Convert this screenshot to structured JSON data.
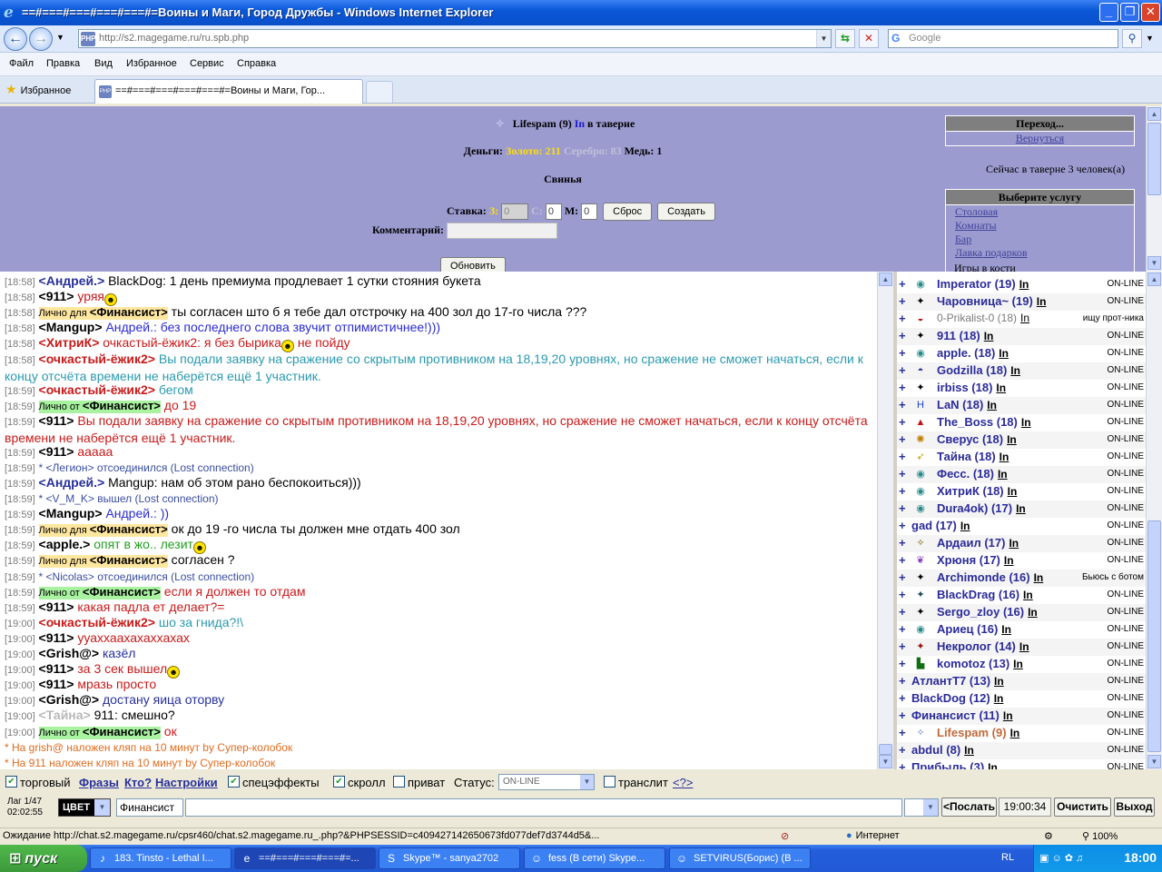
{
  "window": {
    "title": "==#===#===#===#===#=Воины и Маги, Город Дружбы - Windows Internet Explorer"
  },
  "browser": {
    "url": "http://s2.magegame.ru/ru.spb.php",
    "search_placeholder": "Google",
    "menu": [
      "Файл",
      "Правка",
      "Вид",
      "Избранное",
      "Сервис",
      "Справка"
    ],
    "favorites_label": "Избранное",
    "tab_title": "==#===#===#===#===#=Воины и Маги, Гор...",
    "status_text": "Ожидание http://chat.s2.magegame.ru/cpsr460/chat.s2.magegame.ru_.php?&PHPSESSID=c409427142650673fd077def7d3744d5&...",
    "zone": "Интернет",
    "zoom": "100%"
  },
  "tavern": {
    "player": "Lifespam (9)",
    "player_in": "In",
    "location": "в таверне",
    "money_label": "Деньги:",
    "gold": "Золото: 211",
    "silver": "Серебро: 83",
    "copper": "Медь: 1",
    "game": "Свинья",
    "bet_label": "Ставка:",
    "bet_z": "З:",
    "bet_s": "С:",
    "bet_m": "М:",
    "bet_z_val": "0",
    "bet_s_val": "0",
    "bet_m_val": "0",
    "reset": "Сброс",
    "create": "Создать",
    "comment_label": "Комментарий:",
    "refresh": "Обновить",
    "nav_header": "Переход...",
    "nav_back": "Вернуться",
    "occupants": "Сейчас в таверне 3 человек(а)",
    "service_header": "Выберите услугу",
    "services": [
      "Столовая",
      "Комнаты",
      "Бар",
      "Лавка подарков"
    ],
    "dice": "Игры в кости"
  },
  "chat": [
    {
      "ts": "[18:58]",
      "nick": "<Андрей.>",
      "nick_color": "#27309a",
      "text": "BlackDog: 1 день премиума продлевает 1 сутки стояния букета",
      "text_color": "#000000"
    },
    {
      "ts": "[18:58]",
      "nick": "<911>",
      "nick_color": "#000000",
      "text": "уряя",
      "text_color": "#c81a1a",
      "smile": true
    },
    {
      "ts": "[18:58]",
      "priv": "Лично для",
      "priv_type": "to",
      "nick": "<Финансист>",
      "text": "ты согласен што б я тебе дал отстрочку на 400 зол до 17-го числа ???",
      "text_color": "#000000"
    },
    {
      "ts": "[18:58]",
      "nick": "<Mangup>",
      "nick_color": "#000000",
      "text": "Андрей.: без последнего слова звучит отпимистичнее!)))",
      "text_color": "#2b2bd0"
    },
    {
      "ts": "[18:58]",
      "nick": "<ХитриК>",
      "nick_color": "#c81a1a",
      "text": "очкастый-ёжик2: я без бырика",
      "text_color": "#c81a1a",
      "smile": true,
      "after": "не пойду"
    },
    {
      "ts": "[18:58]",
      "nick": "<очкастый-ёжик2>",
      "nick_color": "#c81a1a",
      "text": "Вы подали заявку на сражение со скрытым противником на 18,19,20 уровнях, но сражение не сможет начаться, если к концу отсчёта времени не наберётся ещё 1 участник.",
      "text_color": "#2a9ab0",
      "wrap": true
    },
    {
      "ts": "[18:59]",
      "nick": "<очкастый-ёжик2>",
      "nick_color": "#c81a1a",
      "text": "бегом",
      "text_color": "#2a9ab0"
    },
    {
      "ts": "[18:59]",
      "priv": "Лично от",
      "priv_type": "from",
      "nick": "<Финансист>",
      "text": "до 19",
      "text_color": "#c81a1a"
    },
    {
      "ts": "[18:59]",
      "nick": "<911>",
      "nick_color": "#000000",
      "text": "Вы подали заявку на сражение со скрытым противником на 18,19,20 уровнях, но сражение не сможет начаться, если к концу отсчёта времени не наберётся ещё 1 участник.",
      "text_color": "#c81a1a",
      "wrap": true
    },
    {
      "ts": "[18:59]",
      "nick": "<911>",
      "nick_color": "#000000",
      "text": "ааааа",
      "text_color": "#c81a1a"
    },
    {
      "ts": "[18:59]",
      "sys": "* <Легион> отсоединился (Lost connection)"
    },
    {
      "ts": "[18:59]",
      "nick": "<Андрей.>",
      "nick_color": "#27309a",
      "text": "Mangup: нам об этом рано беспокоиться)))",
      "text_color": "#000000"
    },
    {
      "ts": "[18:59]",
      "sys": "* <V_M_K> вышел (Lost connection)"
    },
    {
      "ts": "[18:59]",
      "nick": "<Mangup>",
      "nick_color": "#000000",
      "text": "Андрей.: ))",
      "text_color": "#2b2bd0"
    },
    {
      "ts": "[18:59]",
      "priv": "Лично для",
      "priv_type": "to",
      "nick": "<Финансист>",
      "text": "ок до 19 -го числа ты должен мне отдать 400 зол",
      "text_color": "#000000"
    },
    {
      "ts": "[18:59]",
      "nick": "<apple.>",
      "nick_color": "#000000",
      "text": "опят в жо.. лезит",
      "text_color": "#22a022",
      "smile": true
    },
    {
      "ts": "[18:59]",
      "priv": "Лично для",
      "priv_type": "to",
      "nick": "<Финансист>",
      "text": "согласен ?",
      "text_color": "#000000"
    },
    {
      "ts": "[18:59]",
      "sys": "* <Nicolas> отсоединился (Lost connection)"
    },
    {
      "ts": "[18:59]",
      "priv": "Лично от",
      "priv_type": "from",
      "nick": "<Финансист>",
      "text": "если я должен то отдам",
      "text_color": "#c81a1a"
    },
    {
      "ts": "[18:59]",
      "nick": "<911>",
      "nick_color": "#000000",
      "text": "какая падла ет делает?=",
      "text_color": "#c81a1a"
    },
    {
      "ts": "[19:00]",
      "nick": "<очкастый-ёжик2>",
      "nick_color": "#c81a1a",
      "text": "шо за гнида?!\\",
      "text_color": "#2a9ab0"
    },
    {
      "ts": "[19:00]",
      "nick": "<911>",
      "nick_color": "#000000",
      "text": "ууаххаахахаххахах",
      "text_color": "#c81a1a"
    },
    {
      "ts": "[19:00]",
      "nick": "<Grish@>",
      "nick_color": "#000000",
      "text": "казёл",
      "text_color": "#27309a"
    },
    {
      "ts": "[19:00]",
      "nick": "<911>",
      "nick_color": "#000000",
      "text": "за 3 сек вышел",
      "text_color": "#c81a1a",
      "smile": true
    },
    {
      "ts": "[19:00]",
      "nick": "<911>",
      "nick_color": "#000000",
      "text": "мразь просто",
      "text_color": "#c81a1a"
    },
    {
      "ts": "[19:00]",
      "nick": "<Grish@>",
      "nick_color": "#000000",
      "text": "достану яица оторву",
      "text_color": "#27309a"
    },
    {
      "ts": "[19:00]",
      "nick": "<Тайна>",
      "nick_color": "#b8b8b8",
      "text": "911: смешно?",
      "text_color": "#000000"
    },
    {
      "ts": "[19:00]",
      "priv": "Лично от",
      "priv_type": "from",
      "nick": "<Финансист>",
      "text": "ок",
      "text_color": "#c81a1a"
    },
    {
      "punish": "* На grish@ наложен кляп на 10 минут by Супер-колобок",
      "who": "grish@"
    },
    {
      "punish": "* На 911 наложен кляп на 10 минут by Супер-колобок",
      "who": "911"
    }
  ],
  "users": [
    {
      "name": "Imperator (19)",
      "in": "In",
      "status": "ON-LINE",
      "icon": "◉",
      "icon_color": "#2a8a8a",
      "name_color": "#2b2b9a"
    },
    {
      "name": "Чаровница~ (19)",
      "in": "In",
      "status": "ON-LINE",
      "icon": "✦",
      "icon_color": "#000",
      "name_color": "#2b2b9a"
    },
    {
      "name": "0-Prikalist-0 (18)",
      "in": "In",
      "status": "ищу прот-ника",
      "icon": "◒",
      "icon_color": "#c01010",
      "name_color": "#7a7a7a",
      "light": true
    },
    {
      "name": "911 (18)",
      "in": "In",
      "status": "ON-LINE",
      "icon": "✦",
      "icon_color": "#000",
      "name_color": "#2b2b9a"
    },
    {
      "name": "apple. (18)",
      "in": "In",
      "status": "ON-LINE",
      "icon": "◉",
      "icon_color": "#2a8a8a",
      "name_color": "#2b2b9a"
    },
    {
      "name": "Godzilla (18)",
      "in": "In",
      "status": "ON-LINE",
      "icon": "◓",
      "icon_color": "#27309a",
      "name_color": "#2b2b9a"
    },
    {
      "name": "irbiss (18)",
      "in": "In",
      "status": "ON-LINE",
      "icon": "✦",
      "icon_color": "#000",
      "name_color": "#2b2b9a"
    },
    {
      "name": "LaN (18)",
      "in": "In",
      "status": "ON-LINE",
      "icon": "H",
      "icon_color": "#1a40d0",
      "name_color": "#2b2b9a"
    },
    {
      "name": "The_Boss (18)",
      "in": "In",
      "status": "ON-LINE",
      "icon": "▲",
      "icon_color": "#c01010",
      "name_color": "#2b2b9a"
    },
    {
      "name": "Сверус (18)",
      "in": "In",
      "status": "ON-LINE",
      "icon": "✺",
      "icon_color": "#c08000",
      "name_color": "#2b2b9a"
    },
    {
      "name": "Тайна (18)",
      "in": "In",
      "status": "ON-LINE",
      "icon": "➶",
      "icon_color": "#c0a000",
      "name_color": "#2b2b9a"
    },
    {
      "name": "Фесс. (18)",
      "in": "In",
      "status": "ON-LINE",
      "icon": "◉",
      "icon_color": "#2a8a8a",
      "name_color": "#2b2b9a"
    },
    {
      "name": "ХитриК (18)",
      "in": "In",
      "status": "ON-LINE",
      "icon": "◉",
      "icon_color": "#2a8a8a",
      "name_color": "#2b2b9a"
    },
    {
      "name": "Dura4ok) (17)",
      "in": "In",
      "status": "ON-LINE",
      "icon": "◉",
      "icon_color": "#2a8a8a",
      "name_color": "#2b2b9a"
    },
    {
      "name": "gad (17)",
      "in": "In",
      "status": "ON-LINE",
      "icon": "",
      "icon_color": "#000",
      "name_color": "#2b2b9a",
      "noicon": true
    },
    {
      "name": "Ардаил (17)",
      "in": "In",
      "status": "ON-LINE",
      "icon": "✧",
      "icon_color": "#806000",
      "name_color": "#2b2b9a"
    },
    {
      "name": "Хрюня (17)",
      "in": "In",
      "status": "ON-LINE",
      "icon": "❦",
      "icon_color": "#8a40c0",
      "name_color": "#2b2b9a"
    },
    {
      "name": "Archimonde (16)",
      "in": "In",
      "status": "Бьюсь с ботом",
      "icon": "✦",
      "icon_color": "#000",
      "name_color": "#2b2b9a"
    },
    {
      "name": "BlackDrag (16)",
      "in": "In",
      "status": "ON-LINE",
      "icon": "✦",
      "icon_color": "#1a4a5a",
      "name_color": "#2b2b9a"
    },
    {
      "name": "Sergo_zloy (16)",
      "in": "In",
      "status": "ON-LINE",
      "icon": "✦",
      "icon_color": "#000",
      "name_color": "#2b2b9a"
    },
    {
      "name": "Ариец (16)",
      "in": "In",
      "status": "ON-LINE",
      "icon": "◉",
      "icon_color": "#2a8a8a",
      "name_color": "#2b2b9a"
    },
    {
      "name": "Некролог (14)",
      "in": "In",
      "status": "ON-LINE",
      "icon": "✦",
      "icon_color": "#a01010",
      "name_color": "#2b2b9a"
    },
    {
      "name": "komotoz (13)",
      "in": "In",
      "status": "ON-LINE",
      "icon": "▙",
      "icon_color": "#107010",
      "name_color": "#2b2b9a"
    },
    {
      "name": "АтлантТ7 (13)",
      "in": "In",
      "status": "ON-LINE",
      "icon": "",
      "icon_color": "#000",
      "name_color": "#2b2b9a",
      "noicon": true
    },
    {
      "name": "BlackDog (12)",
      "in": "In",
      "status": "ON-LINE",
      "icon": "",
      "icon_color": "#000",
      "name_color": "#2b2b9a",
      "noicon": true
    },
    {
      "name": "Финансист (11)",
      "in": "In",
      "status": "ON-LINE",
      "icon": "",
      "icon_color": "#000",
      "name_color": "#2b2b9a",
      "noicon": true
    },
    {
      "name": "Lifespam (9)",
      "in": "In",
      "status": "ON-LINE",
      "icon": "✧",
      "icon_color": "#7080c0",
      "name_color": "#c06a3a",
      "self": true
    },
    {
      "name": "abdul (8)",
      "in": "In",
      "status": "ON-LINE",
      "icon": "",
      "icon_color": "#000",
      "name_color": "#2b2b9a",
      "noicon": true
    },
    {
      "name": "Прибыль (3)",
      "in": "In",
      "status": "ON-LINE",
      "icon": "",
      "icon_color": "#000",
      "name_color": "#2b2b9a",
      "noicon": true
    }
  ],
  "controls": {
    "sound": "торговый",
    "phrases": "Фразы",
    "who": "Кто?",
    "settings": "Настройки",
    "effects": "спецэффекты",
    "scroll": "скролл",
    "private": "приват",
    "status_label": "Статус:",
    "status_value": "ON-LINE",
    "translit": "транслит",
    "translit_link": "<?>",
    "lag": "Лаг 1/47",
    "clock_small": "02:02:55",
    "color": "ЦВЕТ",
    "to_field": "Финансист",
    "send": "<Послать",
    "time": "19:00:34",
    "clear": "Очистить",
    "exit": "Выход"
  },
  "taskbar": {
    "start": "пуск",
    "tasks": [
      {
        "label": "183. Tinsto - Lethal I...",
        "icon": "♪"
      },
      {
        "label": "==#===#===#===#=...",
        "icon": "e",
        "active": true
      },
      {
        "label": "Skype™ - sanya2702",
        "icon": "S"
      },
      {
        "label": "fess (В сети) Skype...",
        "icon": "☺"
      },
      {
        "label": "SETVIRUS(Борис) (В ...",
        "icon": "☺"
      }
    ],
    "lang": "RL",
    "clock": "18:00"
  }
}
